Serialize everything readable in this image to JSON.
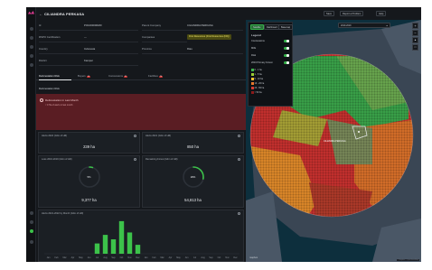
{
  "header": {
    "title": "CILIANDRA PERKASA",
    "buttons": [
      "Save",
      "Report a Problem",
      "Help"
    ]
  },
  "info_table": {
    "rows": [
      {
        "label": "Id",
        "value": "PO1000000183",
        "label2": "Parent Company",
        "value2": "CILIANDRA PERKASA"
      },
      {
        "label": "RSPO Certification",
        "value": "—",
        "label2": "Companies",
        "value2": "First Resources (First Resources (FR))"
      },
      {
        "label": "Country",
        "value": "Indonesia",
        "label2": "Province",
        "value2": "Riau"
      },
      {
        "label": "District",
        "value": "Kampar",
        "label2": "",
        "value2": ""
      }
    ]
  },
  "tabs": [
    {
      "label": "Deforestation Risk",
      "badge": ""
    },
    {
      "label": "Buyers",
      "badge": "10"
    },
    {
      "label": "Concessions",
      "badge": "31"
    },
    {
      "label": "Facilities",
      "badge": "70"
    }
  ],
  "section_title": "Deforestation Risk",
  "alert": {
    "title": "Deforestation in Last Month",
    "subtitle": "< 0 Ha of alerts in last month"
  },
  "cards": {
    "alerts_2022": {
      "title": "Alerts 2022 (Glim of Hill)",
      "value": "239 ha"
    },
    "alerts_2021": {
      "title": "Alerts 2021 (Glim of Hill)",
      "value": "850 ha"
    },
    "loss": {
      "title": "Loss 2016-2019 (Glim of Hill)",
      "value": "9,377 ha",
      "percent": "5%",
      "fraction": 0.05
    },
    "remaining": {
      "title": "Remaining Forest (Glim of Hill)",
      "value": "54,813 ha",
      "percent": "28%",
      "fraction": 0.28
    },
    "monthly": {
      "title": "Alerts 2021-2022 by Month (Glim of Hill)"
    }
  },
  "chart_data": {
    "type": "bar",
    "categories": [
      "Jan",
      "Feb",
      "Mar",
      "Apr",
      "May",
      "Jun",
      "Jul",
      "Aug",
      "Sep",
      "Oct",
      "Nov",
      "Dec",
      "Jan",
      "Feb",
      "Mar",
      "Apr",
      "May",
      "Jun",
      "Jul",
      "Aug",
      "Sep",
      "Oct",
      "Nov",
      "Dec"
    ],
    "values": [
      0,
      0,
      0,
      0,
      0,
      0,
      30,
      55,
      42,
      95,
      62,
      26,
      0,
      0,
      0,
      0,
      0,
      0,
      0,
      0,
      0,
      0,
      0,
      0
    ],
    "ylim": [
      0,
      100
    ],
    "color": "#3cc24a"
  },
  "map": {
    "top_buttons": [
      "Satellite",
      "Dashboard",
      "Basemap"
    ],
    "search_placeholder": "2019-2019",
    "legend_title": "Legend",
    "layers": [
      {
        "label": "Concessions"
      },
      {
        "label": "Mills"
      },
      {
        "label": "Risk"
      },
      {
        "label": "2016 Primary Forest"
      }
    ],
    "risk_levels": [
      {
        "label": "0 - 1 ha",
        "color": "#3cb44b"
      },
      {
        "label": "1 - 5 ha",
        "color": "#9acd32"
      },
      {
        "label": "5 - 10 ha",
        "color": "#f2c12e"
      },
      {
        "label": "10 - 20 ha",
        "color": "#e8772b"
      },
      {
        "label": "20 - 50 ha",
        "color": "#d63a2f"
      },
      {
        "label": "> 50 ha",
        "color": "#8b1a1a"
      }
    ],
    "place_label": "CILIANDRA PERKASA",
    "attribution": "© Mapbox © OpenStreetMap",
    "brand": "mapbox"
  },
  "colors": {
    "accent_green": "#36b24a",
    "alert_red": "#5a1d23",
    "highlight_yellow": "#f2e66a"
  }
}
